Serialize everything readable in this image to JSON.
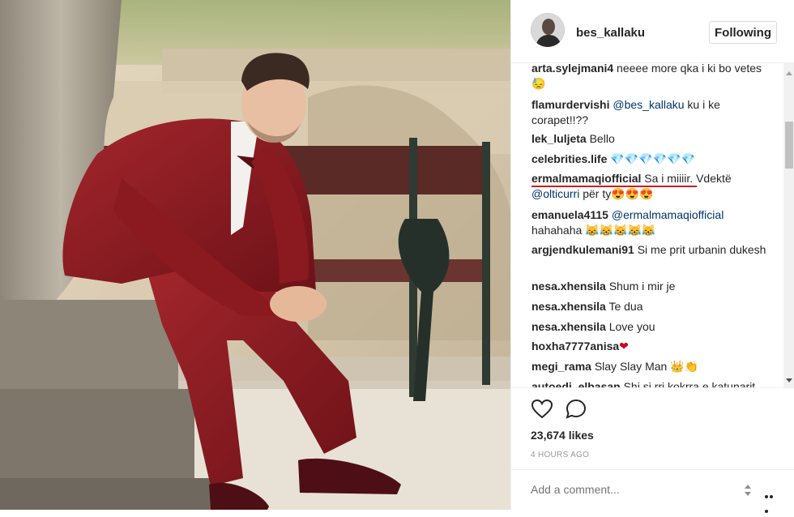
{
  "post": {
    "username": "bes_kallaku",
    "follow_label": "Following",
    "likes": "23,674 likes",
    "timestamp": "4 HOURS AGO",
    "comment_placeholder": "Add a comment..."
  },
  "comments": [
    {
      "user": "arta.sylejmani4",
      "text": " neeee more qka i ki bo vetes 😓"
    },
    {
      "user": "flamurdervishi",
      "mention": " @bes_kallaku",
      "text": " ku i ke corapet!!??"
    },
    {
      "user": "lek_luljeta",
      "text": " Bello"
    },
    {
      "user": "celebrities.life",
      "text": " 💎💎💎💎💎💎"
    },
    {
      "user": "ermalmamaqiofficial",
      "text": " Sa i miiiir. Vdektë ",
      "mention2": "@olticurri",
      "text2": " për ty😍😍😍"
    },
    {
      "user": "emanuela4115",
      "mention": " @ermalmamaqiofficial",
      "text": " hahahaha 😹😹😹😹😹"
    },
    {
      "user": "argjendkulemani91",
      "text": " Si me prit urbanin dukesh"
    },
    {
      "user": "nesa.xhensila",
      "text": " Shum i mir je"
    },
    {
      "user": "nesa.xhensila",
      "text": " Te dua"
    },
    {
      "user": "nesa.xhensila",
      "text": " Love you"
    },
    {
      "user": "hoxha7777anisa",
      "text": "❤"
    },
    {
      "user": "megi_rama",
      "text": " Slay Slay Man 👑👏"
    },
    {
      "user": "autoedi_elbasan",
      "text": " Shi si rri kokrra e katunarit"
    }
  ],
  "icons": {
    "like": "heart-icon",
    "comment": "comment-icon",
    "more": "more-options-icon"
  },
  "colors": {
    "accent_underline": "#d01c1c",
    "mention": "#003569",
    "suit": "#8e1c22"
  }
}
